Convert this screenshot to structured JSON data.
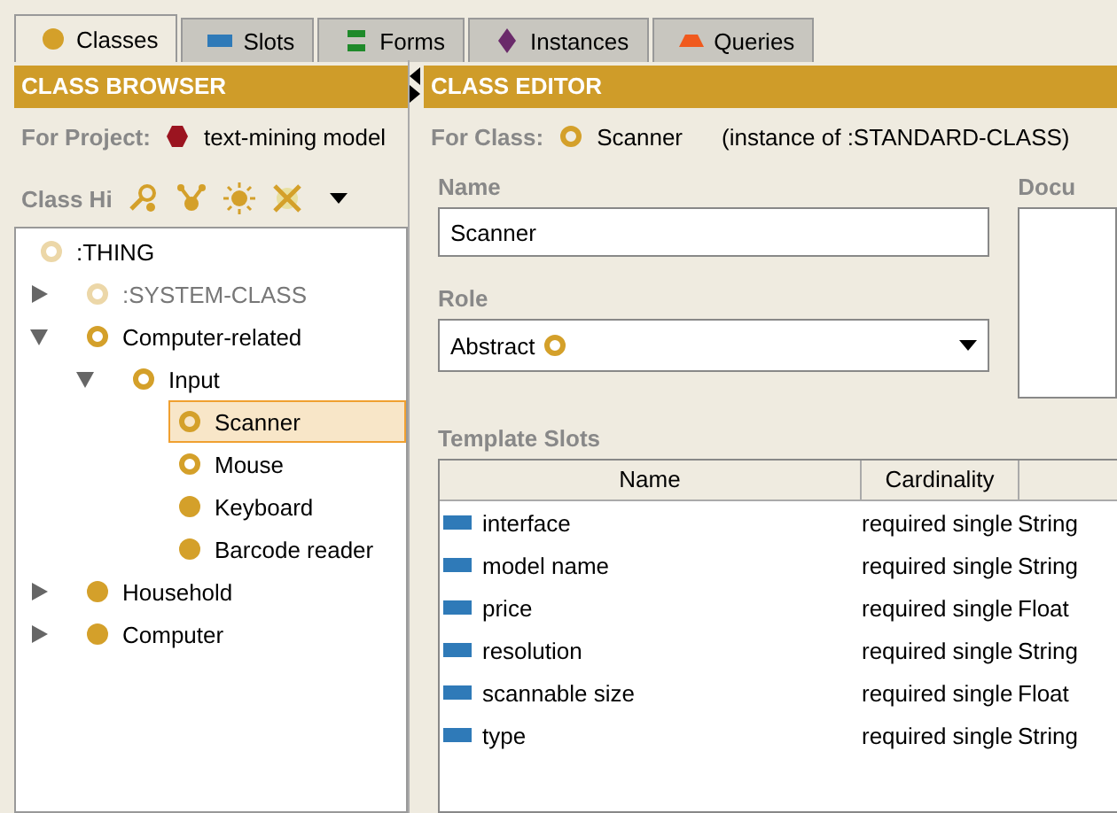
{
  "tabs": [
    {
      "label": "Classes",
      "kind": "class",
      "selected": true
    },
    {
      "label": "Slots",
      "kind": "slot",
      "selected": false
    },
    {
      "label": "Forms",
      "kind": "form",
      "selected": false
    },
    {
      "label": "Instances",
      "kind": "instance",
      "selected": false
    },
    {
      "label": "Queries",
      "kind": "query",
      "selected": false
    }
  ],
  "class_browser": {
    "title": "CLASS BROWSER",
    "project_label": "For Project:",
    "project": "text-mining model",
    "hierarchy_label": "Class Hi",
    "tree": [
      {
        "label": ":THING",
        "kind": "system",
        "selected": false,
        "children": [
          {
            "label": ":SYSTEM-CLASS",
            "kind": "system",
            "expandable": true,
            "expanded": false,
            "selected": false
          },
          {
            "label": "Computer-related",
            "kind": "abstract",
            "expandable": true,
            "expanded": true,
            "selected": false,
            "children": [
              {
                "label": "Input",
                "kind": "abstract",
                "expandable": true,
                "expanded": true,
                "selected": false,
                "children": [
                  {
                    "label": "Scanner",
                    "kind": "abstract",
                    "expandable": false,
                    "selected": true
                  },
                  {
                    "label": "Mouse",
                    "kind": "abstract",
                    "expandable": false,
                    "selected": false
                  },
                  {
                    "label": "Keyboard",
                    "kind": "concrete",
                    "expandable": false,
                    "selected": false
                  },
                  {
                    "label": "Barcode reader",
                    "kind": "concrete",
                    "expandable": false,
                    "selected": false
                  }
                ]
              }
            ]
          },
          {
            "label": "Household",
            "kind": "concrete",
            "expandable": true,
            "expanded": false,
            "selected": false
          },
          {
            "label": "Computer",
            "kind": "concrete",
            "expandable": true,
            "expanded": false,
            "selected": false
          }
        ]
      }
    ]
  },
  "class_editor": {
    "title": "CLASS EDITOR",
    "class_label": "For Class:",
    "class_name": "Scanner",
    "instance_of": "(instance of :STANDARD-CLASS)",
    "name_label": "Name",
    "name_value": "Scanner",
    "doc_label": "Docu",
    "role_label": "Role",
    "role_value": "Abstract",
    "slots_label": "Template Slots",
    "slots_table": {
      "columns": [
        "Name",
        "Cardinality"
      ],
      "rows": [
        {
          "name": "interface",
          "cardinality": "required single",
          "column_3": "String"
        },
        {
          "name": "model name",
          "cardinality": "required single",
          "column_3": "String"
        },
        {
          "name": "price",
          "cardinality": "required single",
          "column_3": "Float"
        },
        {
          "name": "resolution",
          "cardinality": "required single",
          "column_3": "String"
        },
        {
          "name": "scannable size",
          "cardinality": "required single",
          "column_3": "Float"
        },
        {
          "name": "type",
          "cardinality": "required single",
          "column_3": "String"
        }
      ]
    }
  }
}
